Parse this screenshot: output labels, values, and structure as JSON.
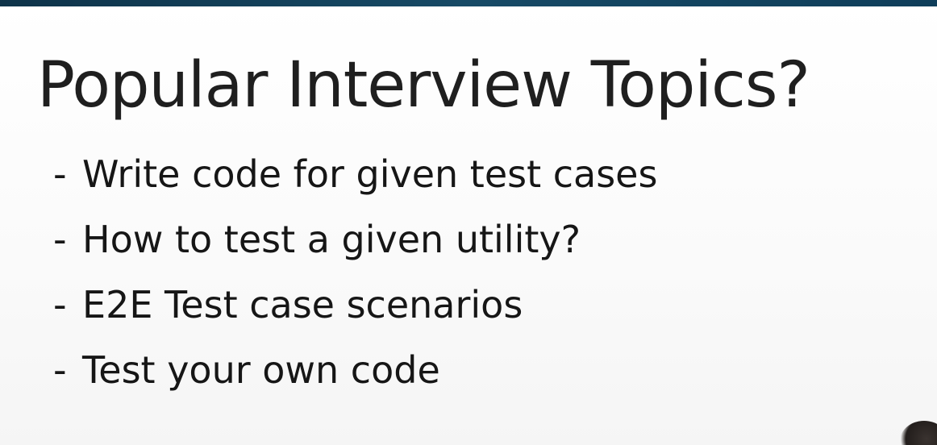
{
  "slide": {
    "title": "Popular Interview Topics?",
    "bullets": [
      "Write code for given test cases",
      "How to test a given utility?",
      "E2E Test case scenarios",
      "Test your own code"
    ],
    "bullet_marker": "-"
  },
  "colors": {
    "top_bar": "#174a66",
    "text": "#1f1f1f",
    "background": "#fbfbfb"
  }
}
